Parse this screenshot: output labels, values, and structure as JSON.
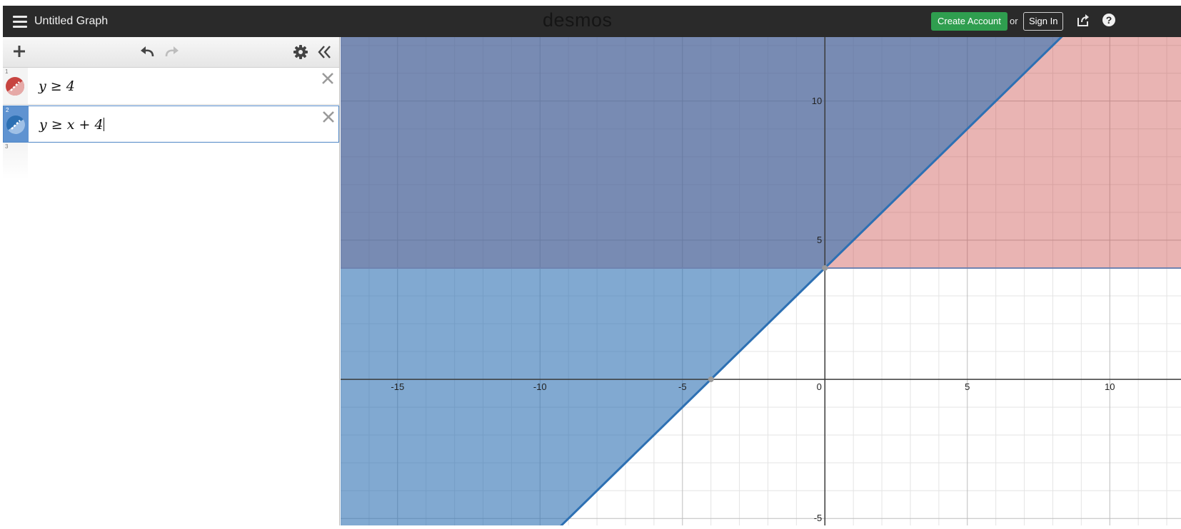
{
  "header": {
    "title": "Untitled Graph",
    "brand": "desmos",
    "create_account": "Create Account",
    "or": "or",
    "sign_in": "Sign In",
    "help": "?"
  },
  "toolbar": {
    "icons": [
      "plus-icon",
      "undo-icon",
      "redo-icon",
      "gear-icon",
      "double-chevron-left-icon"
    ]
  },
  "expressions": [
    {
      "number": "1",
      "latex": "y ≥ 4",
      "color": "#c74440"
    },
    {
      "number": "2",
      "latex": "y ≥ x + 4",
      "color": "#2d70b3"
    },
    {
      "number": "3",
      "latex": ""
    }
  ],
  "graph": {
    "x_range": [
      -17,
      12.5
    ],
    "y_range": [
      -5.25,
      12.3
    ],
    "x_ticks": [
      -15,
      -10,
      -5,
      0,
      5,
      10
    ],
    "y_ticks": [
      -5,
      5,
      10
    ],
    "inequalities": [
      {
        "expression": "y ≥ 4",
        "boundary": "horizontal",
        "value": 4,
        "color": "#c74440"
      },
      {
        "expression": "y ≥ x + 4",
        "boundary": "line",
        "slope": 1,
        "intercept": 4,
        "color": "#2d70b3"
      }
    ],
    "points": [
      [
        0,
        4
      ],
      [
        -4,
        0
      ]
    ]
  }
}
